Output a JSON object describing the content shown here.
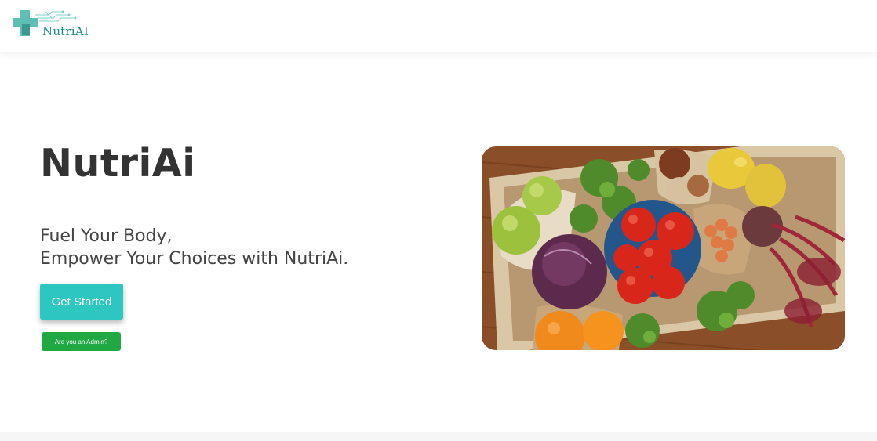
{
  "header": {
    "logo_text": "NutriAI",
    "logo_icon": "medical-cross-icon"
  },
  "hero": {
    "title": "NutriAi",
    "tagline_line1": "Fuel Your Body,",
    "tagline_line2": "Empower Your Choices with NutriAi.",
    "get_started_label": "Get Started",
    "admin_label": "Are you an Admin?",
    "image": "fresh-produce-crate-photo"
  },
  "colors": {
    "accent": "#2ec6c0",
    "admin_green": "#20a843",
    "logo_teal": "#1d8a87",
    "text_dark": "#333333"
  }
}
